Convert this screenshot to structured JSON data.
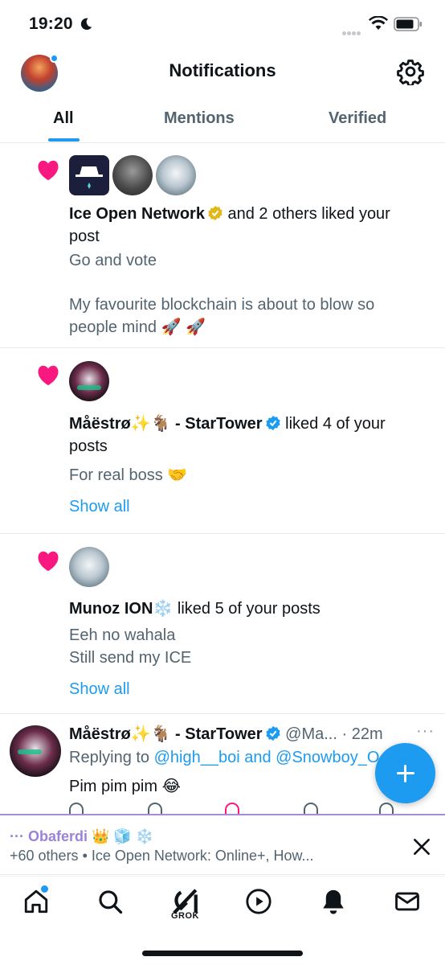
{
  "status_bar": {
    "time": "19:20"
  },
  "header": {
    "title": "Notifications"
  },
  "tabs": [
    {
      "label": "All",
      "active": true
    },
    {
      "label": "Mentions",
      "active": false
    },
    {
      "label": "Verified",
      "active": false
    }
  ],
  "notifications": [
    {
      "type": "like",
      "actor": "Ice Open Network",
      "actor_badge": "gold-verified",
      "action": "and 2 others liked your post",
      "excerpt_line1": "Go and vote",
      "excerpt_line2": "My favourite blockchain is about to blow so people mind 🚀 🚀"
    },
    {
      "type": "like",
      "actor": "Måëstrø✨🐐 - StarTower",
      "actor_badge": "blue-verified",
      "action": "liked 4 of your posts",
      "excerpt_line1": "For real boss 🤝",
      "show_all": "Show all"
    },
    {
      "type": "like",
      "actor": "Munoz ION❄️",
      "action": "liked 5 of your posts",
      "excerpt_line1": "Eeh no wahala",
      "excerpt_line2": "Still send my ICE",
      "show_all": "Show all"
    }
  ],
  "post": {
    "author": "Måëstrø✨🐐 - StarTower",
    "handle": "@Ma...",
    "time": "· 22m",
    "replying_prefix": "Replying to",
    "replying_to": "@high__boi and @Snowboy_O",
    "text": "Pim pim pim 😂"
  },
  "spaces_banner": {
    "host": "··· Obaferdi 👑 🧊 ❄️",
    "subtitle": "+60 others • Ice Open Network: Online+, How..."
  },
  "bottom_nav": {
    "grok_label": "GROK"
  },
  "colors": {
    "accent": "#1d9bf0",
    "like": "#f91880",
    "spaces": "#9b82d8"
  }
}
